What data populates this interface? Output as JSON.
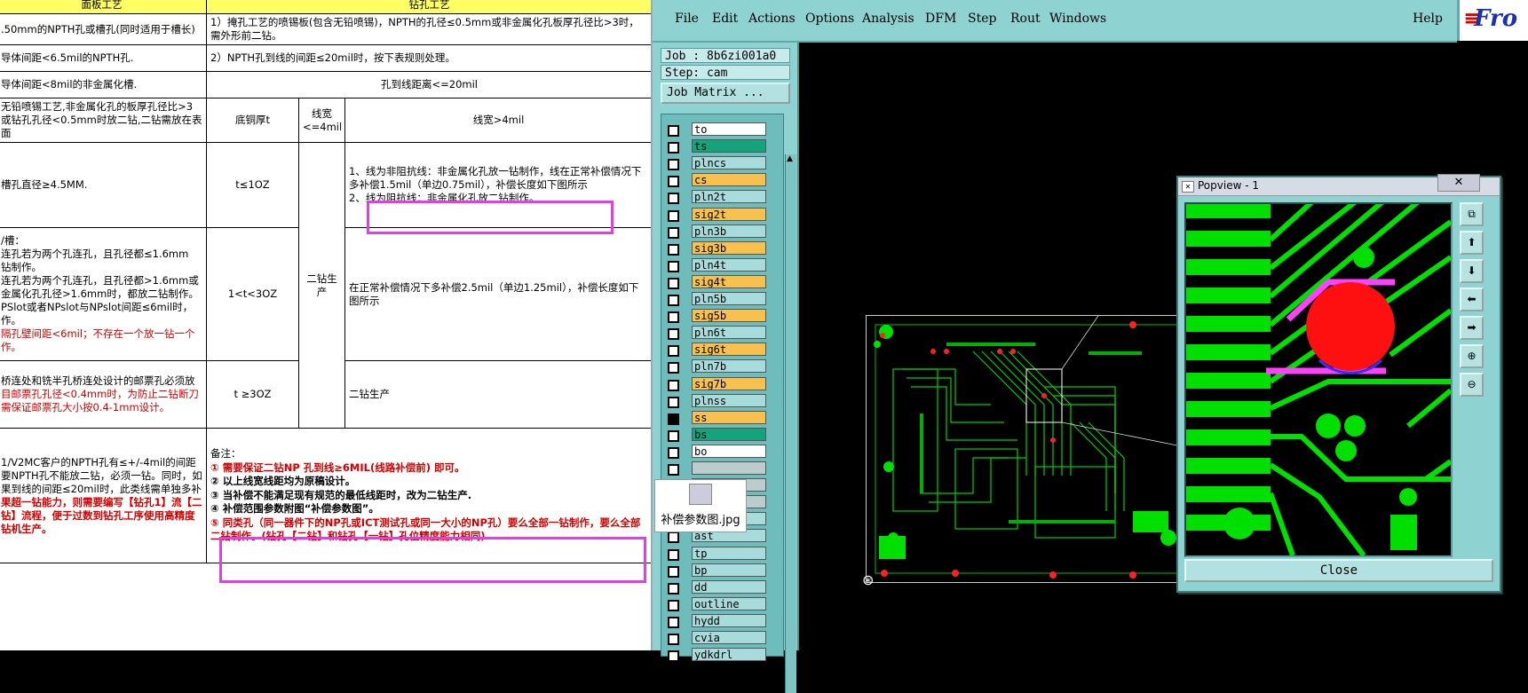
{
  "doc": {
    "header": {
      "left": "面板工艺",
      "right": "钻孔工艺"
    },
    "rows": [
      {
        "left": ".50mm的NPTH孔或槽孔(同时适用于槽长)",
        "right": "1）掩孔工艺的喷锡板(包含无铅喷锡)，NPTH的孔径≤0.5mm或非金属化孔板厚孔径比>3时，需外形前二钻。"
      },
      {
        "left": "导体间距<6.5mil的NPTH孔.",
        "right": "2）NPTH孔到线的间距≤20mil时，按下表规则处理。"
      },
      {
        "left": "导体间距<8mil的非金属化槽.",
        "right": "孔到线距离<=20mil"
      },
      {
        "left": "无铅喷锡工艺,非金属化孔的板厚孔径比>3或钻孔孔径<0.5mm时放二钻,二钻需放在表面",
        "c1": "底铜厚t",
        "c2": "线宽<=4mil",
        "c3": "线宽>4mil"
      },
      {
        "left": "槽孔直径≥4.5MM.",
        "c1": "t≤1OZ",
        "c3a": "1、线为非阻抗线：非金属化孔放一钻制作，线在正常补偿情况下多补偿1.5mil（单边0.75mil），补偿长度如下图所示",
        "c3b": "2、线为阻抗线：非金属化孔放二钻制作。"
      },
      {
        "left_lines": [
          "/槽：",
          "连孔若为两个孔连孔，且孔径都≤1.6mm",
          "钻制作。",
          "连孔若为两个孔连孔，且孔径都>1.6mm或",
          "金属化孔孔径>1.6mm时，都放二钻制作。",
          "PSlot或者NPslot与NPslot间距≤6mil时，",
          "作。"
        ],
        "left_red": "隔孔壁间距<6mil；不存在一个放一钻一个作。",
        "c1": "1<t<3OZ",
        "c2": "二钻生产",
        "c3": "在正常补偿情况下多补偿2.5mil（单边1.25mil），补偿长度如下图所示"
      },
      {
        "left": "桥连处和铣半孔桥连处设计的邮票孔必须放",
        "left_red": "目邮票孔孔径<0.4mm时，为防止二钻断刀需保证邮票孔大小按0.4-1mm设计。",
        "c1": "t ≥3OZ",
        "c3": "二钻生产"
      },
      {
        "left": "1/V2MC客户的NPTH孔有≤+/-4mil的间距要NPTH孔不能放二钻，必须一钻。同时，如果到线的间距≤20mil时，此类线需单独多补",
        "left_red": "果超一钻能力，则需要编写【钻孔1】流【二钻】流程，便于过数到钻孔工序使用高精度钻机生产。",
        "note_title": "备注：",
        "notes": [
          "① 需要保证二钻NP 孔到线≥6MIL(线路补偿前) 即可。",
          "② 以上线宽线距均为原稿设计。",
          "③ 当补偿不能满足现有规范的最低线距时，改为二钻生产.",
          "④ 补偿范围参数附图“补偿参数图”。",
          "⑤ 同类孔（同一器件下的NP孔或ICT测试孔或同一大小的NP孔）要么全部一钻制作，要么全部二钻制作。(钻孔【二钻】和钻孔【一钻】孔位精度能力相同)"
        ]
      }
    ]
  },
  "file_icon": {
    "label": "补偿参数图.jpg"
  },
  "cad": {
    "menu": [
      "File",
      "Edit",
      "Actions",
      "Options",
      "Analysis",
      "DFM",
      "Step",
      "Rout",
      "Windows"
    ],
    "help": "Help",
    "logo": "Fro",
    "job": "Job : 8b6zi001a0",
    "step": "Step: cam",
    "job_matrix": "Job Matrix ...",
    "layers": [
      {
        "name": "to",
        "color": "white"
      },
      {
        "name": "ts",
        "color": "green"
      },
      {
        "name": "plncs",
        "color": "default"
      },
      {
        "name": "cs",
        "color": "orange"
      },
      {
        "name": "pln2t",
        "color": "default"
      },
      {
        "name": "sig2t",
        "color": "orange"
      },
      {
        "name": "pln3b",
        "color": "default"
      },
      {
        "name": "sig3b",
        "color": "orange"
      },
      {
        "name": "pln4t",
        "color": "default"
      },
      {
        "name": "sig4t",
        "color": "orange"
      },
      {
        "name": "pln5b",
        "color": "default"
      },
      {
        "name": "sig5b",
        "color": "orange"
      },
      {
        "name": "pln6t",
        "color": "default"
      },
      {
        "name": "sig6t",
        "color": "orange"
      },
      {
        "name": "pln7b",
        "color": "default"
      },
      {
        "name": "sig7b",
        "color": "orange"
      },
      {
        "name": "plnss",
        "color": "default"
      },
      {
        "name": "ss",
        "color": "orange"
      },
      {
        "name": "bs",
        "color": "green"
      },
      {
        "name": "bo",
        "color": "white"
      },
      {
        "name": "",
        "color": "gray"
      },
      {
        "name": "",
        "color": "gray"
      },
      {
        "name": "",
        "color": "gray"
      },
      {
        "name": "dsb",
        "color": "default"
      },
      {
        "name": "ast",
        "color": "default"
      },
      {
        "name": "tp",
        "color": "default"
      },
      {
        "name": "bp",
        "color": "default"
      },
      {
        "name": "dd",
        "color": "default"
      },
      {
        "name": "outline",
        "color": "default"
      },
      {
        "name": "hydd",
        "color": "default"
      },
      {
        "name": "cvia",
        "color": "default"
      },
      {
        "name": "ydkdrl",
        "color": "default"
      }
    ],
    "popview": {
      "title": "Popview - 1",
      "close": "Close"
    }
  }
}
